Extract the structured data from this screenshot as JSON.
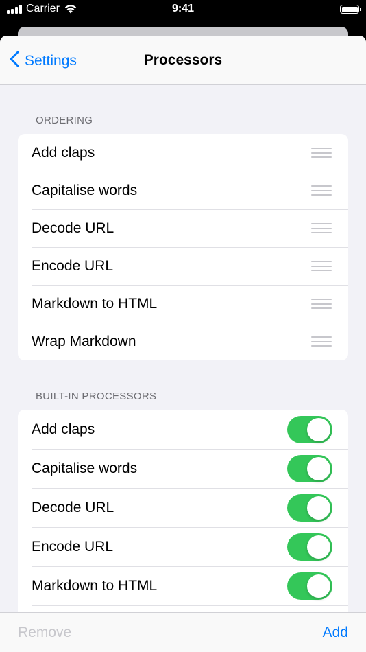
{
  "status_bar": {
    "carrier": "Carrier",
    "time": "9:41",
    "icons": [
      "signal-icon",
      "wifi-icon",
      "battery-icon"
    ]
  },
  "nav": {
    "back_label": "Settings",
    "back_icon": "chevron-left-icon",
    "title": "Processors"
  },
  "ordering": {
    "header": "ORDERING",
    "items": [
      {
        "label": "Add claps"
      },
      {
        "label": "Capitalise words"
      },
      {
        "label": "Decode URL"
      },
      {
        "label": "Encode URL"
      },
      {
        "label": "Markdown to HTML"
      },
      {
        "label": "Wrap Markdown"
      }
    ]
  },
  "builtin": {
    "header": "BUILT-IN PROCESSORS",
    "items": [
      {
        "label": "Add claps",
        "enabled": true
      },
      {
        "label": "Capitalise words",
        "enabled": true
      },
      {
        "label": "Decode URL",
        "enabled": true
      },
      {
        "label": "Encode URL",
        "enabled": true
      },
      {
        "label": "Markdown to HTML",
        "enabled": true
      },
      {
        "label": "",
        "enabled": true
      }
    ]
  },
  "toolbar": {
    "remove_label": "Remove",
    "add_label": "Add"
  },
  "colors": {
    "accent": "#007aff",
    "toggle_on": "#34c759",
    "disabled": "#c7c7cc",
    "background": "#f2f2f7"
  }
}
